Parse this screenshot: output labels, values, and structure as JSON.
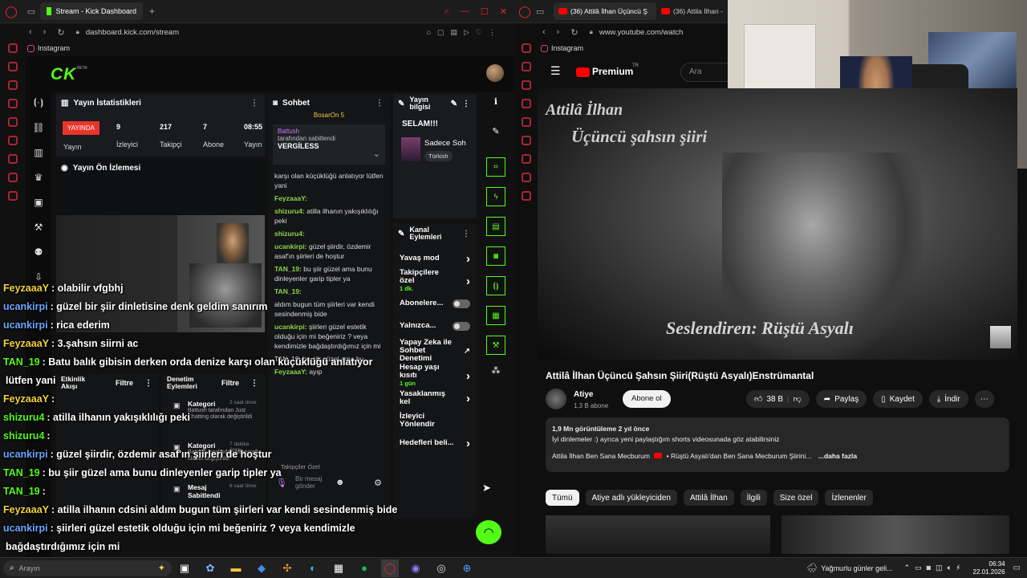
{
  "left_browser": {
    "tab_title": "Stream - Kick Dashboard",
    "url": "dashboard.kick.com/stream",
    "bookmark": "Instagram"
  },
  "kick": {
    "logo": "KICK",
    "beta": "BETA",
    "stats_panel": {
      "title": "Yayın İstatistikleri",
      "live_badge": "YAYINDA",
      "live_label": "Yayın",
      "viewers": "9",
      "viewers_label": "İzleyici",
      "followers": "217",
      "followers_label": "Takipçi",
      "subs": "7",
      "subs_label": "Abone",
      "time": "08:55",
      "time_label": "Yayın"
    },
    "preview_panel": {
      "title": "Yayın Ön İzlemesi"
    },
    "chat_panel": {
      "title": "Sohbet",
      "pinned_top": "BosarOn 5",
      "pinned_user": "Battush",
      "pinned_by": "tarafından sabitlendi",
      "pinned_msg": "VERGİLESS",
      "messages": [
        {
          "user": "",
          "text": "karşı olan küçüklüğü anlatıyor lütfen yani"
        },
        {
          "user": "FeyzaaaY:",
          "text": ""
        },
        {
          "user": "shizuru4:",
          "text": "atilla ilhanın yakışıklılığı peki"
        },
        {
          "user": "shizuru4:",
          "text": ""
        },
        {
          "user": "ucankirpi:",
          "text": "güzel şiirdir, özdemir asaf'ın şiirleri de hoştur"
        },
        {
          "user": "TAN_19:",
          "text": "bu şiir güzel ama bunu dinleyenler garip tipler ya"
        },
        {
          "user": "TAN_19:",
          "text": ""
        },
        {
          "user": "",
          "text": "aldım bugun tüm şiirleri var kendi sesindenmiş bide"
        },
        {
          "user": "ucankirpi:",
          "text": "şiirleri güzel estetik olduğu için mi beğeniriz ? veya kendimizle bağdaştırdığımız için mi"
        },
        {
          "user": "",
          "text": "TAN_19: bu şiir güzel ama bu..."
        },
        {
          "user": "FeyzaaaY:",
          "text": "ayıp"
        }
      ],
      "followers_only": "Takipçiler Özel",
      "input_placeholder": "Bir mesaj gönder"
    },
    "info_panel": {
      "title": "Yayın bilgisi",
      "stream_title": "SELAM!!!",
      "category": "Sadece Soh",
      "tag": "Türkish"
    },
    "actions_panel": {
      "title": "Kanal Eylemleri",
      "items": [
        {
          "label": "Yavaş mod",
          "type": "arrow",
          "sub": ""
        },
        {
          "label": "Takipçilere özel",
          "type": "arrow",
          "sub": "1 dk."
        },
        {
          "label": "Abonelere...",
          "type": "toggle",
          "sub": ""
        },
        {
          "label": "Yalnızca...",
          "type": "toggle",
          "sub": ""
        },
        {
          "label": "Yapay Zeka ile Sohbet Denetimi",
          "type": "link",
          "sub": ""
        },
        {
          "label": "Hesap yaşı kısıtı",
          "type": "arrow",
          "sub": "1 gün"
        },
        {
          "label": "Yasaklanmış kel",
          "type": "arrow",
          "sub": ""
        },
        {
          "label": "İzleyici Yönlendir",
          "type": "none",
          "sub": ""
        },
        {
          "label": "Hedefleri beli...",
          "type": "arrow",
          "sub": ""
        }
      ]
    },
    "activity_panel": {
      "title": "Etkinlik Akışı",
      "filter": "Filtre"
    },
    "audit_panel": {
      "title": "Denetim Eylemleri",
      "filter": "Filtre",
      "items": [
        {
          "title": "Kategori",
          "time": "2 saat önce",
          "desc": "Battush tarafından Just Chatting olarak değiştirildi"
        },
        {
          "title": "Kategori",
          "time": "7 dakika önce",
          "desc": "Battush tarafından Minecraft olarak değiştirildi"
        },
        {
          "title": "Mesaj Sabitlendi",
          "time": "6 saat önce",
          "desc": ""
        }
      ]
    }
  },
  "overlay_chat": [
    {
      "user": "FeyzaaaY",
      "text": ": olabilir vfgbhj",
      "color": "#f2d43a"
    },
    {
      "user": "ucankirpi",
      "text": ": güzel bir şiir dinletisine denk geldim sanırım",
      "color": "#6aa6ff"
    },
    {
      "user": "ucankirpi",
      "text": ": rica ederim",
      "color": "#6aa6ff"
    },
    {
      "user": "FeyzaaaY",
      "text": ": 3.şahsın siirni ac",
      "color": "#f2d43a"
    },
    {
      "user": "TAN_19",
      "text": ": Batu balık gibisin derken orda denize karşı olan küçüklüğü anlatıyor",
      "color": "#53fc18"
    },
    {
      "user": "",
      "text": "lütfen yani",
      "color": "#fff"
    },
    {
      "user": "FeyzaaaY",
      "text": ":",
      "color": "#f2d43a"
    },
    {
      "user": "shizuru4",
      "text": ": atilla ilhanın yakışıklılığı peki",
      "color": "#53fc18"
    },
    {
      "user": "shizuru4",
      "text": ":",
      "color": "#53fc18"
    },
    {
      "user": "ucankirpi",
      "text": ": güzel şiirdir, özdemir asaf'ın şiirleri de hoştur",
      "color": "#6aa6ff"
    },
    {
      "user": "TAN_19",
      "text": ": bu şiir güzel ama bunu dinleyenler garip tipler ya",
      "color": "#53fc18"
    },
    {
      "user": "TAN_19",
      "text": ":",
      "color": "#53fc18"
    },
    {
      "user": "FeyzaaaY",
      "text": ": atilla ilhanın cdsini aldım bugun tüm şiirleri var kendi sesindenmiş bide",
      "color": "#f2d43a"
    },
    {
      "user": "ucankirpi",
      "text": ": şiirleri güzel estetik olduğu için mi beğeniriz ? veya kendimizle",
      "color": "#6aa6ff"
    },
    {
      "user": "",
      "text": "bağdaştırdığımız için mi",
      "color": "#fff"
    }
  ],
  "right_browser": {
    "tabs": [
      "(36) Attilâ İlhan Üçüncü Ş",
      "(36) Attila İlhan -"
    ],
    "url": "www.youtube.com/watch",
    "bookmark": "Instagram"
  },
  "youtube": {
    "logo": "Premium",
    "tr": "TR",
    "search_placeholder": "Ara",
    "video_text_1": "Attilâ İlhan",
    "video_text_2": "Üçüncü şahsın şiiri",
    "video_text_3": "Seslendiren: Rüştü Asyalı",
    "title": "Attilâ İlhan Üçüncü Şahsın Şiiri(Rüştü Asyalı)Enstrümantal",
    "channel": "Atiye",
    "subscribers": "1,3 B abone",
    "subscribe": "Abone ol",
    "likes": "38 B",
    "share": "Paylaş",
    "save": "Kaydet",
    "download": "İndir",
    "views": "1,9 Mn görüntüleme  2 yıl önce",
    "desc1": "İyi dinlemeler :) ayrıca yeni paylaştığım shorts videosunada göz atabilirsiniz",
    "desc2": "Attila İlhan Ben Sana Mecburum",
    "desc3": "• Rüştü Asyalı'dan Ben Sana Mecburum Şiirini...",
    "more": "...daha fazla",
    "chips": [
      "Tümü",
      "Atiye adlı yükleyiciden",
      "Attilâ İlhan",
      "İlgili",
      "Size özel",
      "İzlenenler"
    ]
  },
  "taskbar": {
    "search": "Arayın",
    "weather": "Yağmurlu günler geli...",
    "time": "06:34",
    "date": "22.01.2026"
  }
}
